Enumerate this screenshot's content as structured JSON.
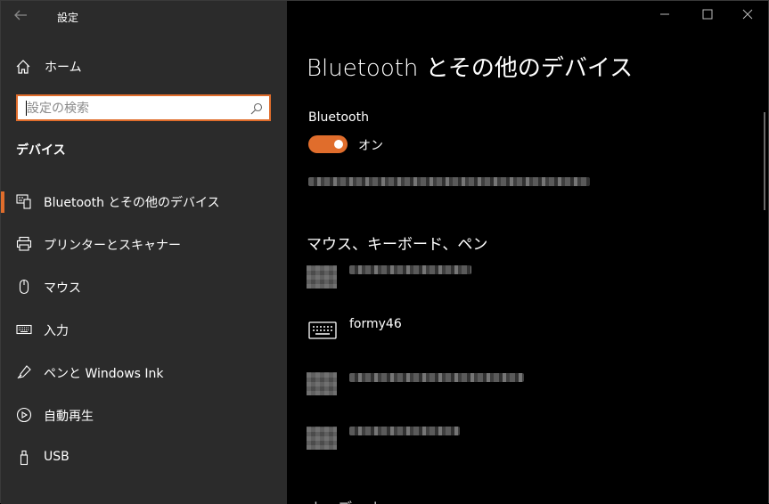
{
  "window": {
    "title": "設定",
    "controls": [
      "minimize",
      "maximize",
      "close"
    ]
  },
  "sidebar": {
    "home_label": "ホーム",
    "search_placeholder": "設定の検索",
    "section_title": "デバイス",
    "items": [
      {
        "label": "Bluetooth とその他のデバイス",
        "icon": "bluetooth-devices-icon",
        "selected": true
      },
      {
        "label": "プリンターとスキャナー",
        "icon": "printer-icon",
        "selected": false
      },
      {
        "label": "マウス",
        "icon": "mouse-icon",
        "selected": false
      },
      {
        "label": "入力",
        "icon": "keyboard-input-icon",
        "selected": false
      },
      {
        "label": "ペンと Windows Ink",
        "icon": "pen-icon",
        "selected": false
      },
      {
        "label": "自動再生",
        "icon": "autoplay-icon",
        "selected": false
      },
      {
        "label": "USB",
        "icon": "usb-icon",
        "selected": false
      }
    ]
  },
  "main": {
    "page_title": "Bluetooth とその他の​デバイス",
    "bluetooth_label": "Bluetooth",
    "bluetooth_state": "オン",
    "group_title": "マウス、キーボード、ペン",
    "devices": [
      {
        "name": "formy46",
        "icon": "keyboard-icon"
      }
    ],
    "partial_next_heading": "オーディオ"
  },
  "colors": {
    "accent": "#e06d2c",
    "sidebar_bg": "#2b2b2b",
    "main_bg": "#000000"
  }
}
